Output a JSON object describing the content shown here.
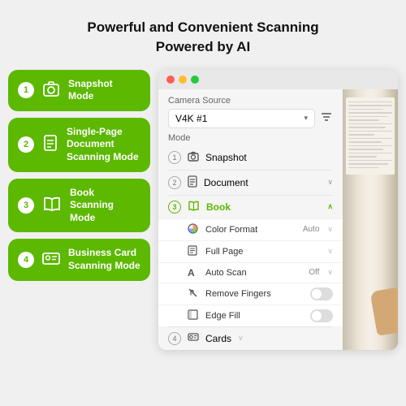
{
  "header": {
    "line1": "Powerful and Convenient Scanning",
    "line2": "Powered by AI"
  },
  "left_modes": [
    {
      "number": "1",
      "label": "Snapshot Mode",
      "icon": "📷"
    },
    {
      "number": "2",
      "label": "Single-Page Document Scanning Mode",
      "icon": "📄"
    },
    {
      "number": "3",
      "label": "Book Scanning Mode",
      "icon": "📖"
    },
    {
      "number": "4",
      "label": "Business Card Scanning Mode",
      "icon": "🪪"
    }
  ],
  "app": {
    "camera_source_label": "Camera Source",
    "camera_value": "V4K #1",
    "mode_label": "Mode",
    "modes": [
      {
        "number": "1",
        "icon": "📷",
        "label": "Snapshot",
        "chevron": "∨",
        "active": false
      },
      {
        "number": "2",
        "icon": "📄",
        "label": "Document",
        "chevron": "∨",
        "active": false
      },
      {
        "number": "3",
        "icon": "📖",
        "label": "Book",
        "chevron": "∧",
        "active": true
      }
    ],
    "sub_options": [
      {
        "icon": "🎨",
        "label": "Color Format",
        "value": "Auto",
        "type": "dropdown"
      },
      {
        "icon": "⬜",
        "label": "Full Page",
        "value": "",
        "type": "dropdown"
      },
      {
        "icon": "A",
        "label": "Auto Scan",
        "value": "Off",
        "type": "dropdown"
      },
      {
        "icon": "✂️",
        "label": "Remove Fingers",
        "value": "",
        "type": "toggle",
        "on": false
      },
      {
        "icon": "⬛",
        "label": "Edge Fill",
        "value": "",
        "type": "toggle",
        "on": false
      }
    ],
    "cards_number": "4",
    "cards_icon": "🪪",
    "cards_label": "Cards",
    "cards_chevron": "∨"
  },
  "colors": {
    "green": "#5cb800",
    "accent": "#5cb800"
  }
}
